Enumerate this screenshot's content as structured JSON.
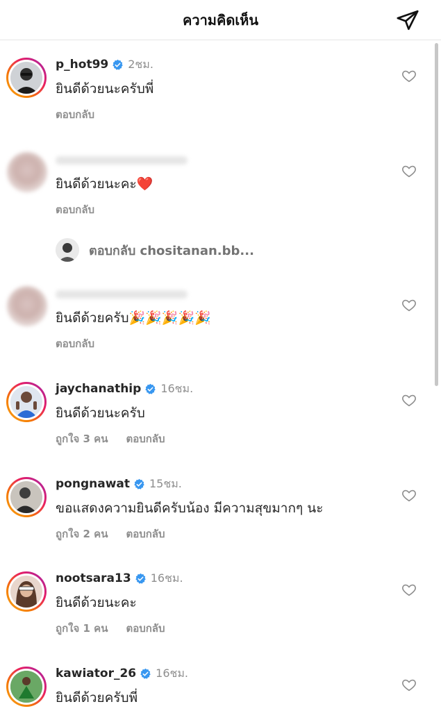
{
  "header": {
    "title": "ความคิดเห็น",
    "send_icon": "paper-plane-icon"
  },
  "comments": [
    {
      "username": "p_hot99",
      "verified": true,
      "time": "2ชม.",
      "text": "ยินดีด้วยนะครับพี่",
      "likes": "",
      "reply": "ตอบกลับ",
      "story_ring": true,
      "avatar_color": "#3a3a3a"
    },
    {
      "username": "",
      "verified": false,
      "time": "",
      "text": "ยินดีด้วยนะคะ",
      "emoji": "❤️",
      "likes": "",
      "reply": "ตอบกลับ",
      "blurred": true
    },
    {
      "username": "",
      "verified": false,
      "time": "",
      "text": "ยินดีด้วยครับ",
      "emoji": "🎉🎉🎉🎉🎉",
      "likes": "",
      "reply": "ตอบกลับ",
      "blurred": true
    },
    {
      "username": "jaychanathip",
      "verified": true,
      "time": "16ชม.",
      "text": "ยินดีด้วยนะครับ",
      "likes": "ถูกใจ 3 คน",
      "reply": "ตอบกลับ",
      "story_ring": true,
      "avatar_color": "#2b6cd6"
    },
    {
      "username": "pongnawat",
      "verified": true,
      "time": "15ชม.",
      "text": "ขอแสดงความยินดีครับน้อง มีความสุขมากๆ นะ",
      "likes": "ถูกใจ 2 คน",
      "reply": "ตอบกลับ",
      "story_ring": true,
      "avatar_color": "#4a4a4a"
    },
    {
      "username": "nootsara13",
      "verified": true,
      "time": "16ชม.",
      "text": "ยินดีด้วยนะคะ",
      "likes": "ถูกใจ 1 คน",
      "reply": "ตอบกลับ",
      "story_ring": true,
      "avatar_color": "#8a6a5a"
    },
    {
      "username": "kawiator_26",
      "verified": true,
      "time": "16ชม.",
      "text": "ยินดีด้วยครับพี่",
      "likes": "",
      "reply": "",
      "story_ring": true,
      "avatar_color": "#2f8a3a"
    }
  ],
  "view_replies": {
    "text": "ตอบกลับ chositanan.bb..."
  },
  "colors": {
    "verified_blue": "#3897f0",
    "secondary_text": "#8e8e8e",
    "primary_text": "#262626"
  },
  "icons": {
    "verified": "verified-badge-icon",
    "like": "heart-outline-icon"
  }
}
